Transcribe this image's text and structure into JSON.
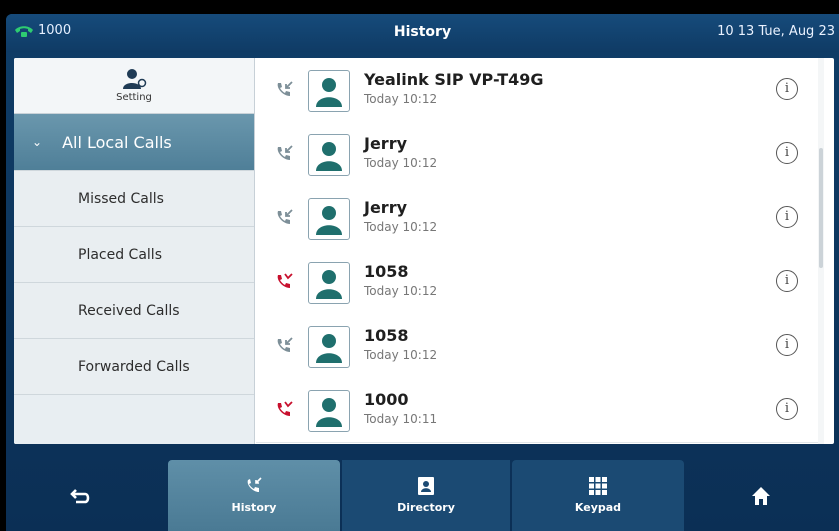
{
  "status_bar": {
    "line": "1000",
    "title": "History",
    "datetime": "10 13 Tue, Aug 23"
  },
  "sidebar": {
    "setting_label": "Setting",
    "items": [
      {
        "label": "All Local Calls",
        "active": true
      },
      {
        "label": "Missed Calls"
      },
      {
        "label": "Placed Calls"
      },
      {
        "label": "Received Calls"
      },
      {
        "label": "Forwarded Calls"
      }
    ]
  },
  "calls": [
    {
      "name": "Yealink SIP VP-T49G",
      "time": "Today 10:12",
      "type": "received"
    },
    {
      "name": "Jerry",
      "time": "Today 10:12",
      "type": "received"
    },
    {
      "name": "Jerry",
      "time": "Today 10:12",
      "type": "received"
    },
    {
      "name": "1058",
      "time": "Today 10:12",
      "type": "missed"
    },
    {
      "name": "1058",
      "time": "Today 10:12",
      "type": "received"
    },
    {
      "name": "1000",
      "time": "Today 10:11",
      "type": "missed"
    }
  ],
  "info_glyph": "i",
  "toolbar": {
    "history": "History",
    "directory": "Directory",
    "keypad": "Keypad"
  },
  "colors": {
    "missed": "#c8102e",
    "received": "#7d8f98",
    "accent": "#4f7f98",
    "line_active": "#2ecc71"
  },
  "icons": [
    "phone-icon",
    "setting-icon",
    "chevron-down-icon",
    "avatar-icon",
    "info-icon",
    "back-icon",
    "history-icon",
    "directory-icon",
    "keypad-icon",
    "home-icon"
  ]
}
